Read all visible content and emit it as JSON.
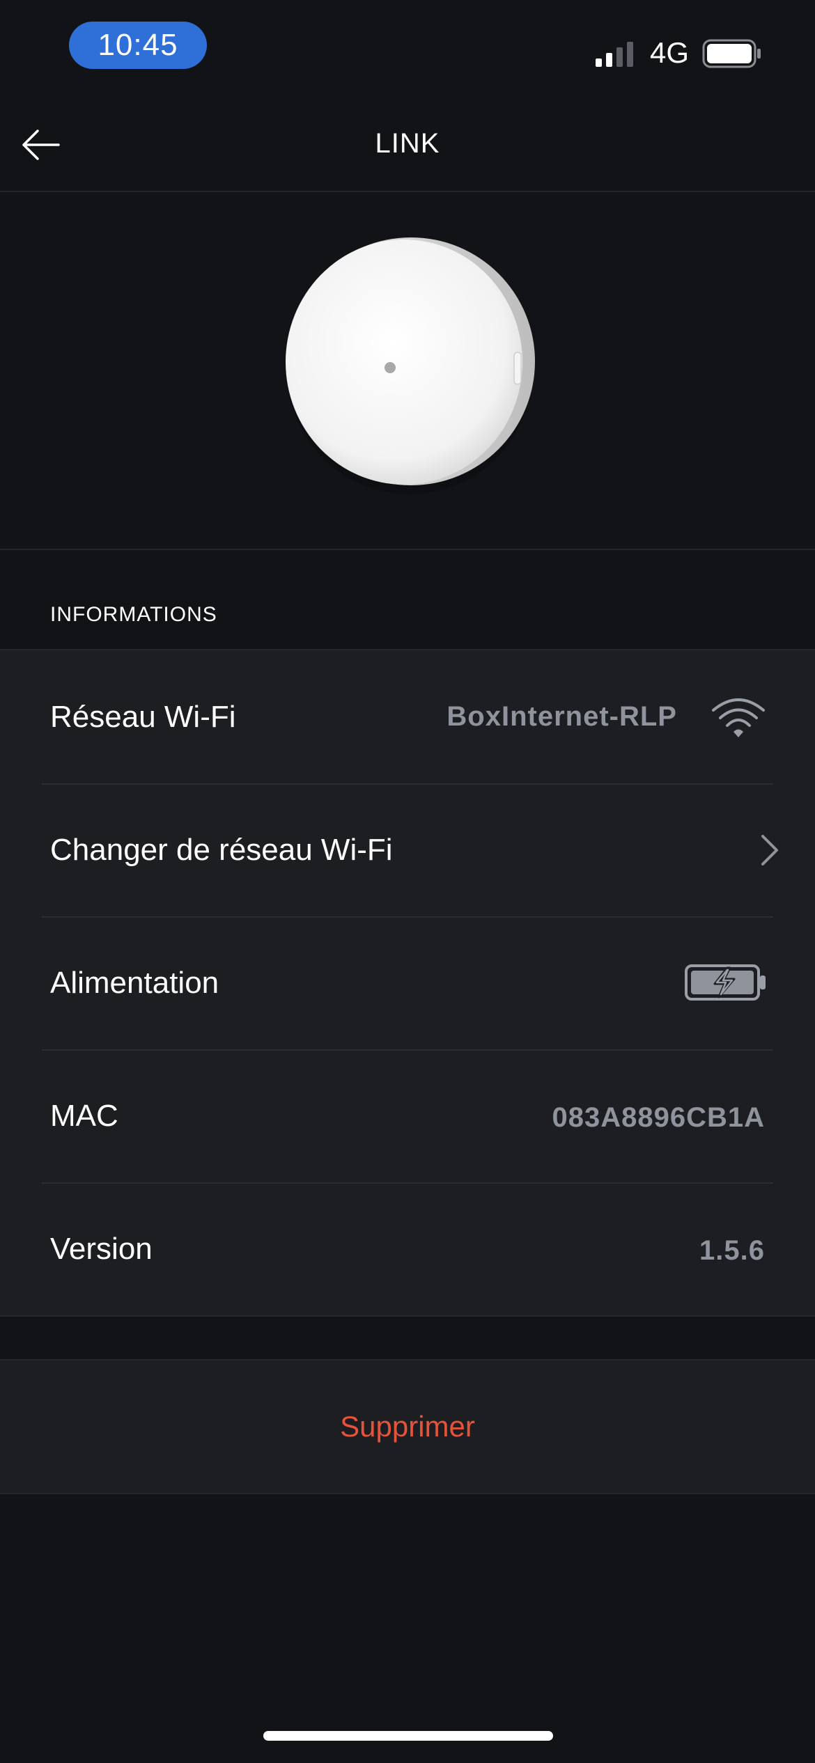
{
  "status_bar": {
    "time": "10:45",
    "network": "4G",
    "signal_icon": "signal-bars-icon",
    "battery_icon": "battery-icon"
  },
  "header": {
    "title": "LINK",
    "back_icon": "arrow-left-icon"
  },
  "device": {
    "image": "link-device-puck"
  },
  "informations": {
    "section_title": "INFORMATIONS",
    "rows": [
      {
        "label": "Réseau Wi-Fi",
        "value": "BoxInternet-RLP",
        "icon": "wifi-icon"
      },
      {
        "label": "Changer de réseau Wi-Fi",
        "icon": "chevron-right-icon"
      },
      {
        "label": "Alimentation",
        "icon": "battery-charging-icon"
      },
      {
        "label": "MAC",
        "value": "083A8896CB1A"
      },
      {
        "label": "Version",
        "value": "1.5.6"
      }
    ]
  },
  "actions": {
    "delete_label": "Supprimer"
  },
  "colors": {
    "accent_blue": "#2f6fd8",
    "danger": "#e5533a",
    "background": "#121316",
    "card": "#1d1e22",
    "muted_value": "#8e939c"
  }
}
